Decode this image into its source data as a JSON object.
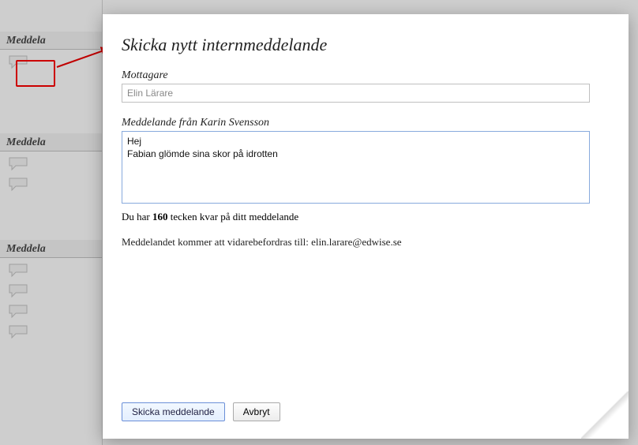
{
  "sidebar": {
    "column_label": "Meddela"
  },
  "arrow": {
    "color": "#c00000"
  },
  "modal": {
    "title": "Skicka nytt internmeddelande",
    "recipient_label": "Mottagare",
    "recipient_value": "Elin Lärare",
    "message_label": "Meddelande från Karin Svensson",
    "message_value": "Hej\nFabian glömde sina skor på idrotten",
    "counter_prefix": "Du har ",
    "counter_number": "160",
    "counter_suffix": " tecken kvar på ditt meddelande",
    "forward_prefix": "Meddelandet kommer att vidarebefordras till: ",
    "forward_email": "elin.larare@edwise.se",
    "send_label": "Skicka meddelande",
    "cancel_label": "Avbryt"
  }
}
